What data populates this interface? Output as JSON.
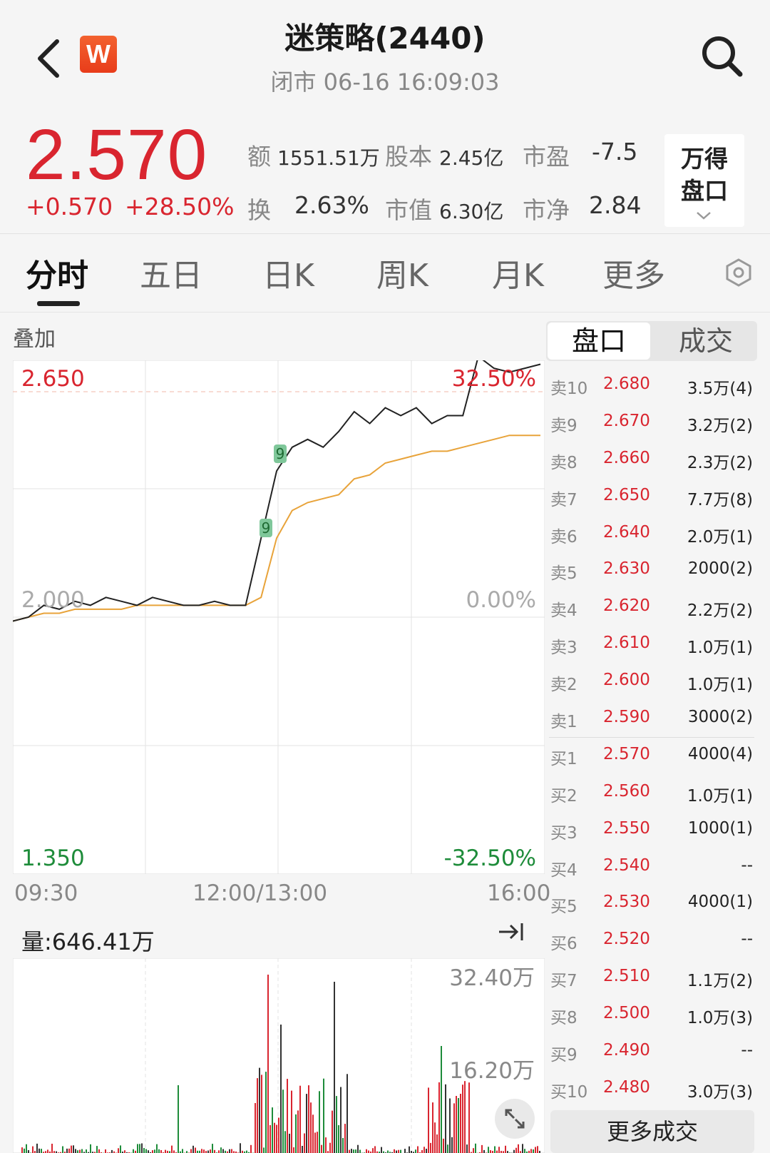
{
  "header": {
    "back_icon": "chevron-left-icon",
    "logo_text": "W",
    "title": "迷策略(2440)",
    "subtitle": "闭市 06-16 16:09:03",
    "search_icon": "search-icon"
  },
  "quote": {
    "price": "2.570",
    "change": "+0.570",
    "change_pct": "+28.50%",
    "turnover_label": "额",
    "turnover": "1551.51万",
    "share_cap_label": "股本",
    "share_cap": "2.45亿",
    "pe_label": "市盈",
    "pe": "-7.5",
    "turnover_rate_label": "换",
    "turnover_rate": "2.63%",
    "market_cap_label": "市值",
    "market_cap": "6.30亿",
    "pb_label": "市净",
    "pb": "2.84",
    "wind_button": [
      "万得",
      "盘口"
    ]
  },
  "tabs": [
    "分时",
    "五日",
    "日K",
    "周K",
    "月K",
    "更多"
  ],
  "active_tab": "分时",
  "settings_icon": "hexagon-settings-icon",
  "chart": {
    "overlay_label": "叠加",
    "y_top": "2.650",
    "y_mid": "2.000",
    "y_bottom": "1.350",
    "pct_top": "32.50%",
    "pct_mid": "0.00%",
    "pct_bottom": "-32.50%",
    "x_labels": [
      "09:30",
      "12:00/13:00",
      "16:00"
    ],
    "marker_text": "9",
    "volume_label": "量:646.41万",
    "vol_top": "32.40万",
    "vol_mid": "16.20万",
    "colors": {
      "up": "#d9252f",
      "down": "#1e8c3a",
      "price_line": "#222222",
      "avg_line": "#e8a33a"
    }
  },
  "chart_data": {
    "type": "line",
    "title": "",
    "xlabel": "",
    "ylabel": "",
    "ylim": [
      1.35,
      2.65
    ],
    "y2lim": [
      "-32.50%",
      "32.50%"
    ],
    "x_ticks": [
      "09:30",
      "12:00/13:00",
      "16:00"
    ],
    "series": [
      {
        "values": [
          1.99,
          2.0,
          2.03,
          2.02,
          2.04,
          2.03,
          2.05,
          2.04,
          2.03,
          2.05,
          2.04,
          2.03,
          2.03,
          2.04,
          2.03,
          2.03,
          2.2,
          2.37,
          2.43,
          2.45,
          2.43,
          2.47,
          2.52,
          2.49,
          2.53,
          2.51,
          2.53,
          2.49,
          2.51,
          2.51,
          2.66,
          2.63,
          2.62,
          2.63,
          2.64
        ]
      },
      {
        "values": [
          1.99,
          2.0,
          2.01,
          2.01,
          2.02,
          2.02,
          2.02,
          2.02,
          2.03,
          2.03,
          2.03,
          2.03,
          2.03,
          2.03,
          2.03,
          2.03,
          2.05,
          2.2,
          2.27,
          2.29,
          2.3,
          2.31,
          2.35,
          2.36,
          2.39,
          2.4,
          2.41,
          2.42,
          2.42,
          2.43,
          2.44,
          2.45,
          2.46,
          2.46,
          2.46
        ]
      }
    ]
  },
  "order_book": {
    "asks": [
      {
        "label": "卖10",
        "price": "2.680",
        "vol": "3.5万(4)"
      },
      {
        "label": "卖9",
        "price": "2.670",
        "vol": "3.2万(2)"
      },
      {
        "label": "卖8",
        "price": "2.660",
        "vol": "2.3万(2)"
      },
      {
        "label": "卖7",
        "price": "2.650",
        "vol": "7.7万(8)"
      },
      {
        "label": "卖6",
        "price": "2.640",
        "vol": "2.0万(1)"
      },
      {
        "label": "卖5",
        "price": "2.630",
        "vol": "2000(2)"
      },
      {
        "label": "卖4",
        "price": "2.620",
        "vol": "2.2万(2)"
      },
      {
        "label": "卖3",
        "price": "2.610",
        "vol": "1.0万(1)"
      },
      {
        "label": "卖2",
        "price": "2.600",
        "vol": "1.0万(1)"
      },
      {
        "label": "卖1",
        "price": "2.590",
        "vol": "3000(2)"
      }
    ],
    "bids": [
      {
        "label": "买1",
        "price": "2.570",
        "vol": "4000(4)"
      },
      {
        "label": "买2",
        "price": "2.560",
        "vol": "1.0万(1)"
      },
      {
        "label": "买3",
        "price": "2.550",
        "vol": "1000(1)"
      },
      {
        "label": "买4",
        "price": "2.540",
        "vol": "--"
      },
      {
        "label": "买5",
        "price": "2.530",
        "vol": "4000(1)"
      },
      {
        "label": "买6",
        "price": "2.520",
        "vol": "--"
      },
      {
        "label": "买7",
        "price": "2.510",
        "vol": "1.1万(2)"
      },
      {
        "label": "买8",
        "price": "2.500",
        "vol": "1.0万(3)"
      },
      {
        "label": "买9",
        "price": "2.490",
        "vol": "--"
      },
      {
        "label": "买10",
        "price": "2.480",
        "vol": "3.0万(3)"
      }
    ],
    "tabs": [
      "盘口",
      "成交"
    ],
    "more_button": "更多成交"
  }
}
